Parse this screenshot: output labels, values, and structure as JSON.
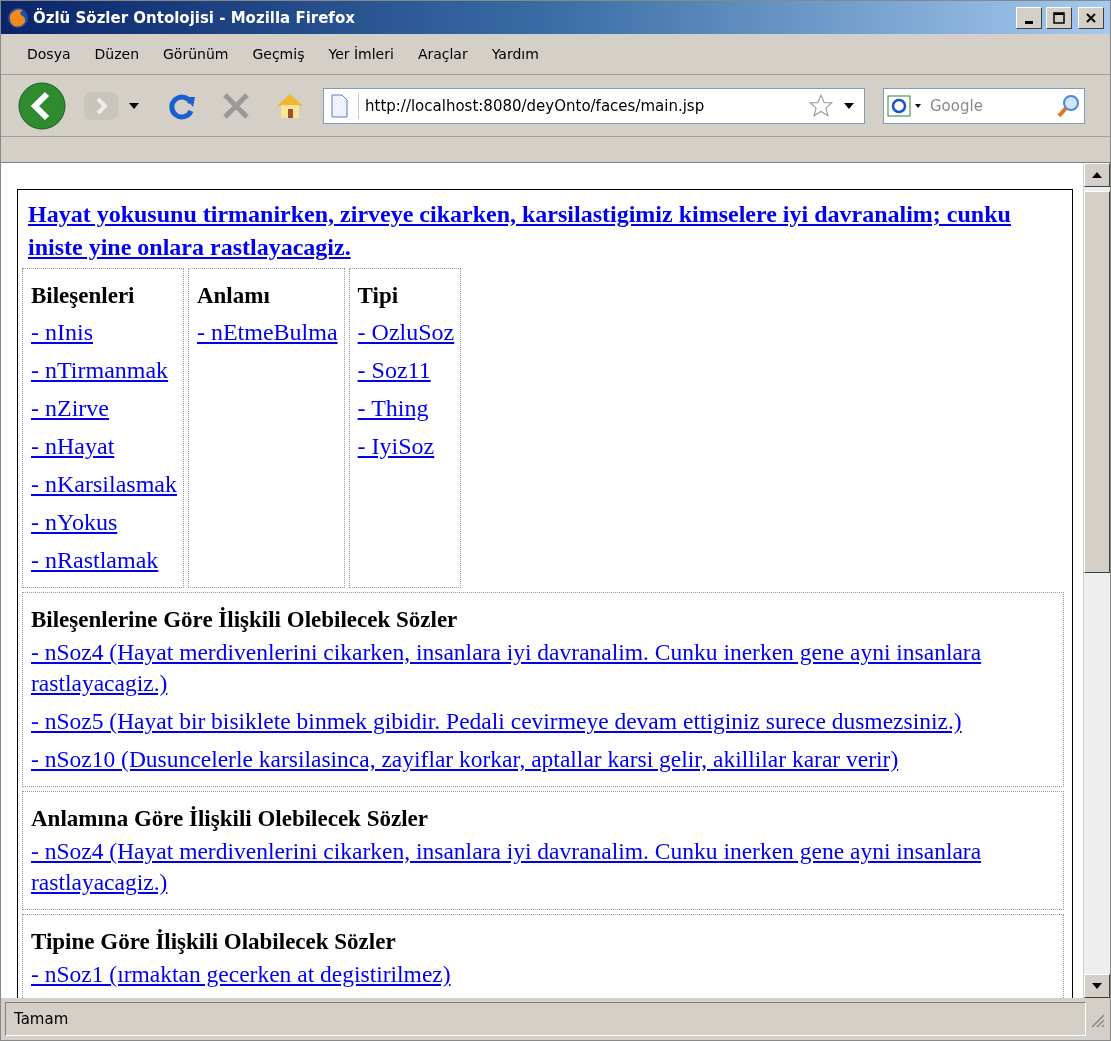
{
  "window": {
    "title": "Özlü Sözler Ontolojisi - Mozilla Firefox"
  },
  "menu": [
    "Dosya",
    "Düzen",
    "Görünüm",
    "Geçmiş",
    "Yer İmleri",
    "Araçlar",
    "Yardım"
  ],
  "toolbar": {
    "url": "http://localhost:8080/deyOnto/faces/main.jsp",
    "search_placeholder": "Google"
  },
  "page": {
    "title": "Hayat yokusunu tirmanirken, zirveye cikarken, karsilastigimiz kimselere iyi davranalim; cunku iniste yine onlara rastlayacagiz.",
    "columns": [
      {
        "heading": "Bileşenleri",
        "links": [
          "- nInis",
          "- nTirmanmak",
          "- nZirve",
          "- nHayat",
          "- nKarsilasmak",
          "- nYokus",
          "- nRastlamak"
        ]
      },
      {
        "heading": "Anlamı",
        "links": [
          "- nEtmeBulma"
        ]
      },
      {
        "heading": "Tipi",
        "links": [
          "- OzluSoz",
          "- Soz11",
          "- Thing",
          "- IyiSoz"
        ]
      }
    ],
    "sections": [
      {
        "heading": "Bileşenlerine Göre İlişkili Olebilecek Sözler",
        "links": [
          "- nSoz4 (Hayat merdivenlerini cikarken, insanlara iyi davranalim. Cunku inerken gene ayni insanlara rastlayacagiz.)",
          "- nSoz5 (Hayat bir bisiklete binmek gibidir. Pedali cevirmeye devam ettiginiz surece dusmezsiniz.)",
          "- nSoz10 (Dusuncelerle karsilasinca, zayiflar korkar, aptallar karsi gelir, akillilar karar verir)"
        ]
      },
      {
        "heading": "Anlamına Göre İlişkili Olebilecek Sözler",
        "links": [
          "- nSoz4 (Hayat merdivenlerini cikarken, insanlara iyi davranalim. Cunku inerken gene ayni insanlara rastlayacagiz.)"
        ]
      },
      {
        "heading": "Tipine Göre İlişkili Olabilecek Sözler",
        "links": [
          "- nSoz1 (ırmaktan gecerken at degistirilmez)"
        ]
      }
    ]
  },
  "status_bar": "Tamam"
}
